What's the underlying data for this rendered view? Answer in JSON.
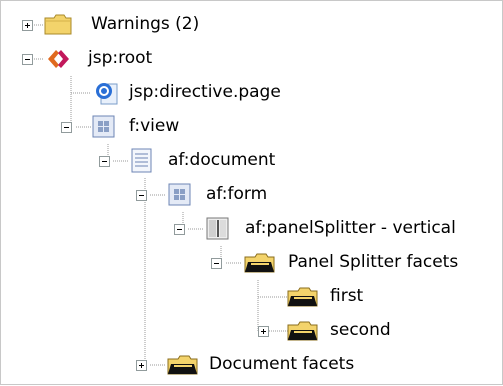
{
  "tree": {
    "nodes": [
      {
        "label": "Warnings (2)",
        "icon": "folder-icon"
      },
      {
        "label": "jsp:root",
        "icon": "jsp-root-icon"
      },
      {
        "label": "jsp:directive.page",
        "icon": "directive-icon"
      },
      {
        "label": "f:view",
        "icon": "view-component-icon"
      },
      {
        "label": "af:document",
        "icon": "document-icon"
      },
      {
        "label": "af:form",
        "icon": "form-component-icon"
      },
      {
        "label": "af:panelSplitter - vertical",
        "icon": "panel-splitter-icon"
      },
      {
        "label": "Panel Splitter facets",
        "icon": "facet-folder-icon"
      },
      {
        "label": "first",
        "icon": "facet-folder-icon"
      },
      {
        "label": "second",
        "icon": "facet-folder-icon"
      },
      {
        "label": "Document facets",
        "icon": "facet-folder-icon"
      }
    ]
  },
  "colors": {
    "folder": "#f3d36b",
    "jsp": "#e06a1f",
    "directive": "#2a6fd6",
    "component": "#8a9fc5",
    "treeLine": "#9a9a9a"
  }
}
